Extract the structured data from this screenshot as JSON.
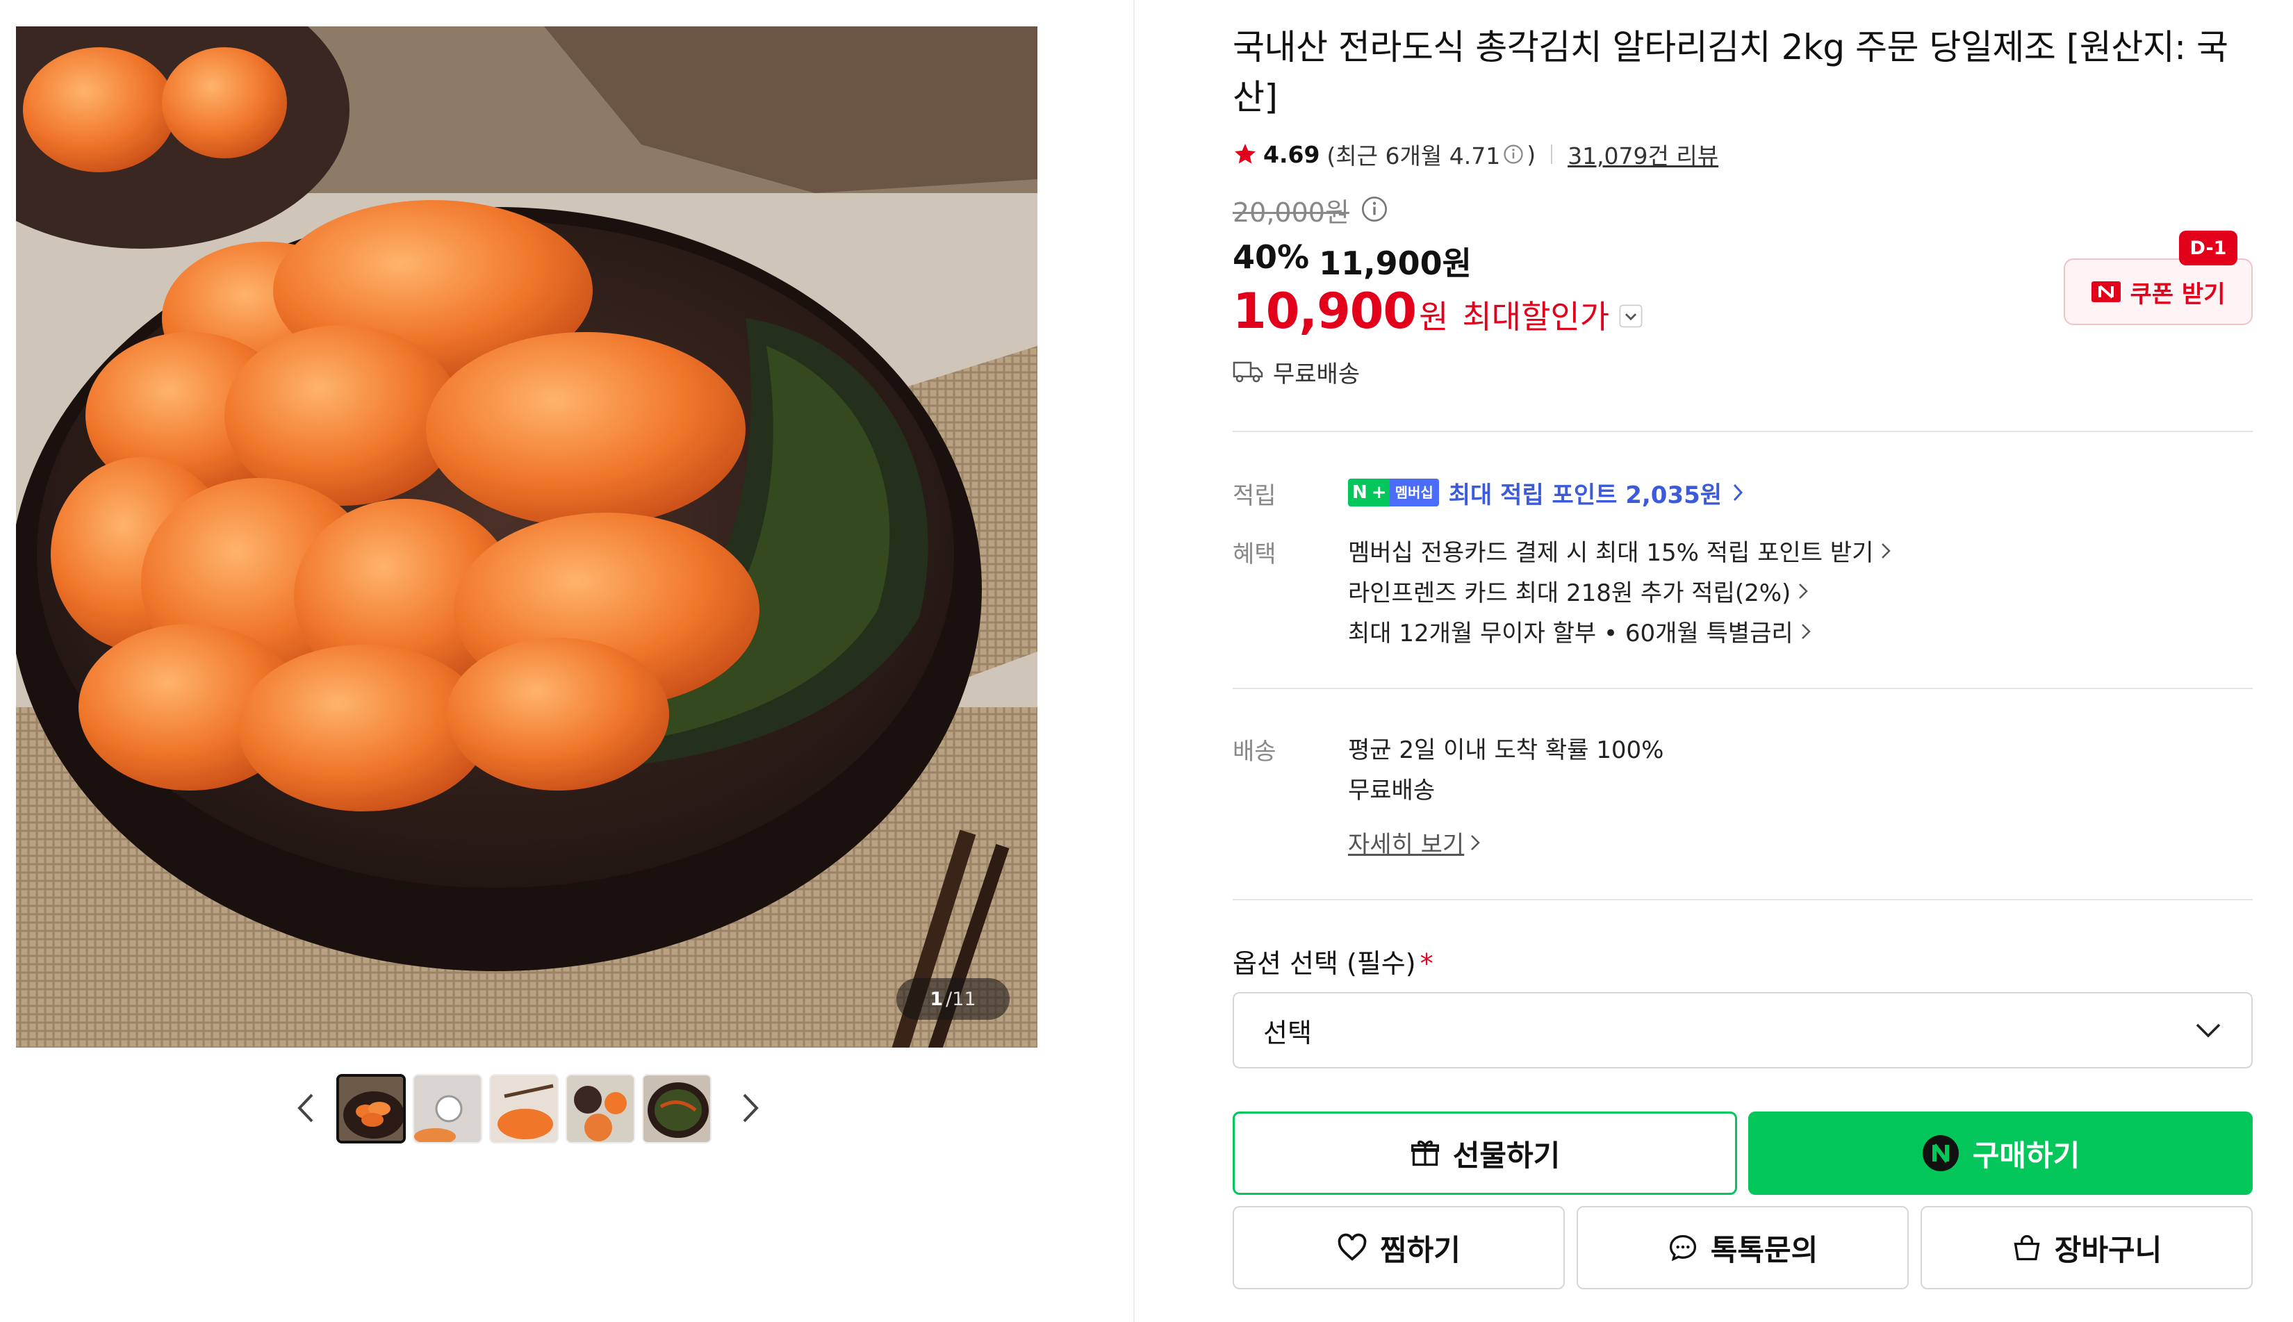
{
  "gallery": {
    "counter_current": "1",
    "counter_total": "/11",
    "thumbnail_count": 5,
    "active_thumbnail": 1
  },
  "product": {
    "title": "국내산 전라도식 총각김치 알타리김치 2kg 주문 당일제조 [원산지: 국산]",
    "rating": "4.69",
    "recent_rating": "(최근 6개월 4.71",
    "recent_rating_close": ")",
    "review_link": "31,079건 리뷰"
  },
  "price": {
    "original": "20,000원",
    "discount_rate": "40%",
    "sale_price": "11,900원",
    "final_price": "10,900",
    "final_unit": "원",
    "final_label": "최대할인가"
  },
  "coupon": {
    "dday": "D-1",
    "label": "쿠폰 받기",
    "accent": "#e3001b"
  },
  "shipping": {
    "free_label": "무료배송"
  },
  "points": {
    "section_label": "적립",
    "badge_n": "N",
    "badge_plus": "+",
    "badge_mem": "멤버십",
    "text": "최대 적립 포인트 2,035원"
  },
  "benefits": {
    "section_label": "혜택",
    "items": [
      "멤버십 전용카드 결제 시 최대 15% 적립 포인트 받기",
      "라인프렌즈 카드 최대 218원 추가 적립(2%)",
      "최대 12개월 무이자 할부 • 60개월 특별금리"
    ]
  },
  "delivery": {
    "section_label": "배송",
    "line1": "평균 2일 이내 도착 확률 100%",
    "line2": "무료배송",
    "detail_link": "자세히 보기"
  },
  "options": {
    "label": "옵션 선택 (필수)",
    "required_mark": "*",
    "selected": "선택"
  },
  "actions": {
    "gift": "선물하기",
    "buy": "구매하기",
    "wish": "찜하기",
    "talk": "톡톡문의",
    "cart": "장바구니"
  },
  "colors": {
    "brand_green": "#03c75a",
    "price_red": "#e3001b",
    "membership_blue": "#3b5bdb"
  }
}
